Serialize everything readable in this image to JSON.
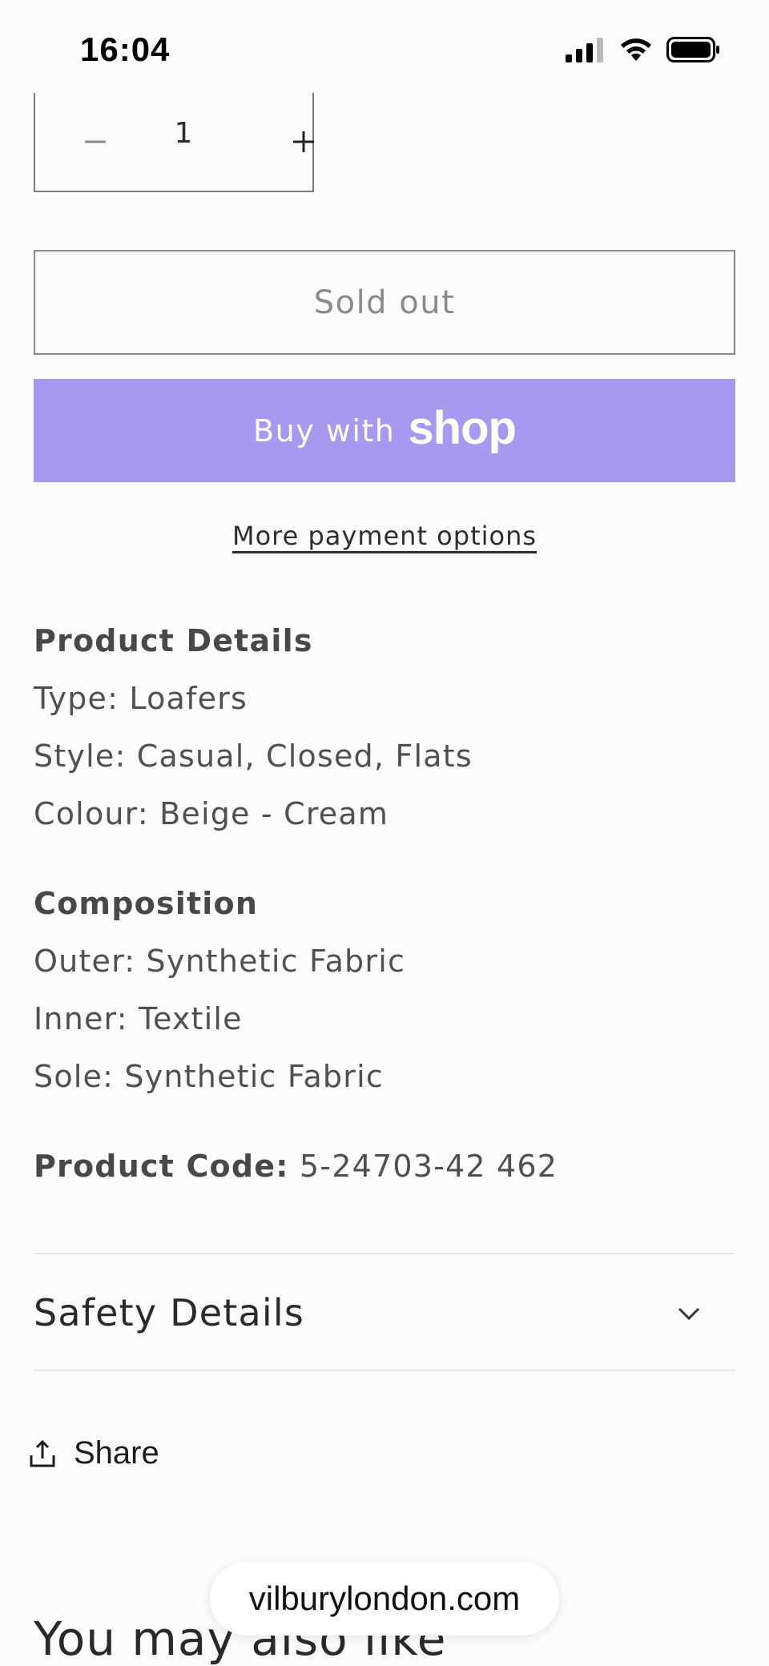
{
  "status_bar": {
    "time": "16:04"
  },
  "quantity": {
    "value": "1"
  },
  "buttons": {
    "sold_out": "Sold out",
    "buy_with": "Buy with",
    "shop_brand": "shop",
    "more_payment": "More payment options"
  },
  "product_details": {
    "heading": "Product Details",
    "lines": [
      "Type: Loafers",
      "Style: Casual, Closed, Flats",
      "Colour: Beige - Cream"
    ]
  },
  "composition": {
    "heading": "Composition",
    "lines": [
      "Outer: Synthetic Fabric",
      "Inner: Textile",
      "Sole: Synthetic Fabric"
    ]
  },
  "product_code": {
    "label": "Product Code:",
    "value": "5-24703-42 462"
  },
  "accordion": {
    "safety_label": "Safety Details"
  },
  "share": {
    "label": "Share"
  },
  "recommendations": {
    "heading": "You may also like"
  },
  "browser": {
    "url": "vilburylondon.com"
  }
}
